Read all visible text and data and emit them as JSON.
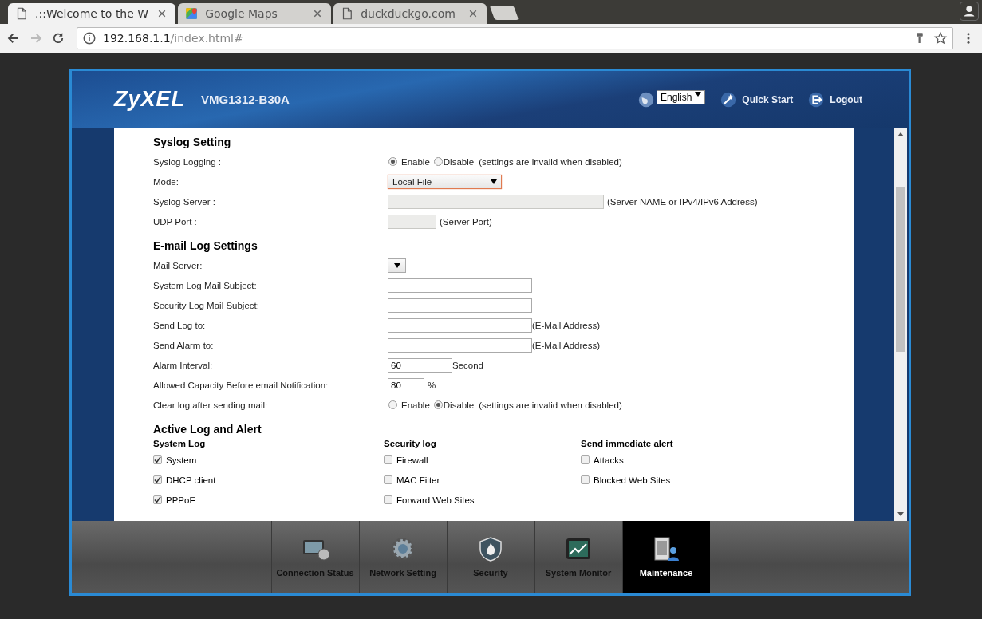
{
  "browser": {
    "tabs": [
      {
        "title": ".::Welcome to the W",
        "selected": true,
        "kind": "page"
      },
      {
        "title": "Google Maps",
        "selected": false,
        "kind": "map"
      },
      {
        "title": "duckduckgo.com",
        "selected": false,
        "kind": "page"
      }
    ],
    "url_host": "192.168.1.1",
    "url_path": "/index.html#"
  },
  "header": {
    "logo": "ZyXEL",
    "model": "VMG1312-B30A",
    "language": "English",
    "quick_start": "Quick Start",
    "logout": "Logout"
  },
  "sections": [
    {
      "title": "Syslog Setting",
      "rows": [
        {
          "kind": "radio",
          "label": "Syslog Logging :",
          "options": [
            {
              "label": "Enable",
              "selected": true
            },
            {
              "label": "Disable",
              "selected": false
            }
          ],
          "note": "(settings are invalid when disabled)"
        },
        {
          "kind": "select",
          "label": "Mode:",
          "value": "Local File",
          "focused": true
        },
        {
          "kind": "input",
          "label": "Syslog Server :",
          "disabled": true,
          "note": "(Server NAME or IPv4/IPv6 Address)"
        },
        {
          "kind": "input",
          "label": "UDP Port :",
          "disabled": true,
          "note": "(Server Port)"
        }
      ]
    },
    {
      "title": "E-mail Log Settings",
      "rows": [
        {
          "kind": "select",
          "label": "Mail Server:",
          "focused": false
        },
        {
          "kind": "input",
          "label": "System Log Mail Subject:",
          "disabled": false
        },
        {
          "kind": "input",
          "label": "Security Log Mail Subject:",
          "disabled": false
        },
        {
          "kind": "input",
          "label": "Send Log to:",
          "disabled": false,
          "note": "(E-Mail Address)"
        },
        {
          "kind": "input",
          "label": "Send Alarm to:",
          "disabled": false,
          "note": "(E-Mail Address)"
        },
        {
          "kind": "input",
          "label": "Alarm Interval:",
          "disabled": false,
          "value": "60",
          "note": "Second"
        },
        {
          "kind": "input",
          "label": "Allowed Capacity Before email Notification:",
          "disabled": false,
          "value": "80",
          "note": "%"
        },
        {
          "kind": "radio",
          "label": "Clear log after sending mail:",
          "options": [
            {
              "label": "Enable",
              "selected": false
            },
            {
              "label": "Disable",
              "selected": true
            }
          ],
          "note": "(settings are invalid when disabled)"
        }
      ]
    }
  ],
  "active_log": {
    "title": "Active Log and Alert",
    "columns": [
      {
        "heading": "System Log",
        "items": [
          {
            "label": "System",
            "checked": true
          },
          {
            "label": "DHCP client",
            "checked": true
          },
          {
            "label": "PPPoE",
            "checked": true
          }
        ]
      },
      {
        "heading": "Security log",
        "items": [
          {
            "label": "Firewall",
            "checked": false
          },
          {
            "label": "MAC Filter",
            "checked": false
          },
          {
            "label": "Forward Web Sites",
            "checked": false
          }
        ]
      },
      {
        "heading": "Send immediate alert",
        "items": [
          {
            "label": "Attacks",
            "checked": false
          },
          {
            "label": "Blocked Web Sites",
            "checked": false
          }
        ]
      }
    ]
  },
  "nav": [
    {
      "label": "Connection Status",
      "kind": "monitor",
      "selected": false
    },
    {
      "label": "Network Setting",
      "kind": "gear",
      "selected": false
    },
    {
      "label": "Security",
      "kind": "shield",
      "selected": false
    },
    {
      "label": "System Monitor",
      "kind": "chart",
      "selected": false
    },
    {
      "label": "Maintenance",
      "kind": "server",
      "selected": true
    }
  ]
}
